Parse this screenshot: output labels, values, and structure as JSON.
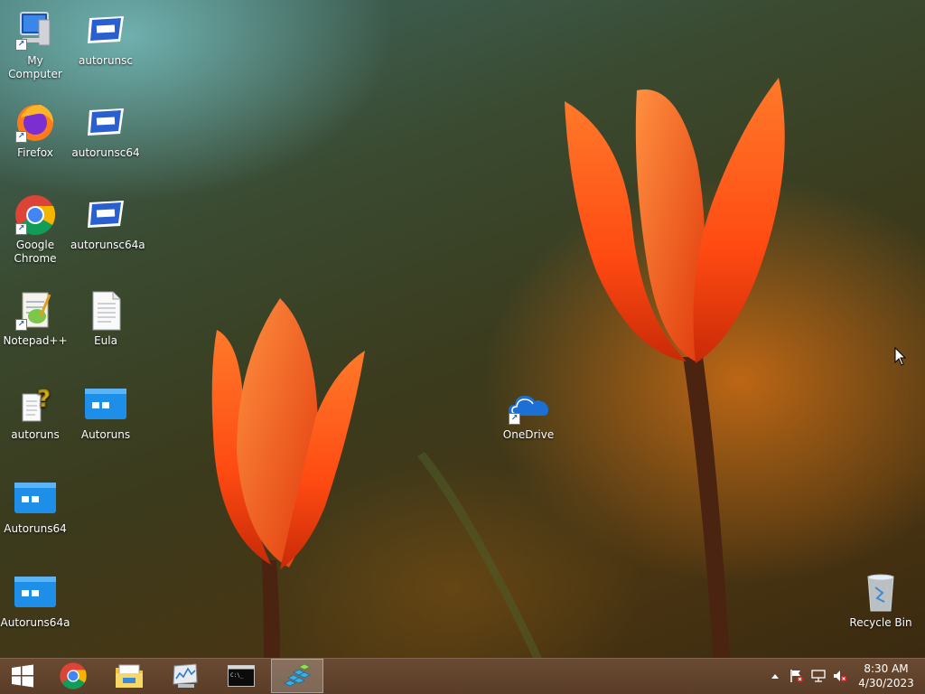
{
  "desktop": {
    "icons": [
      {
        "label": "My Computer",
        "icon": "computer-icon"
      },
      {
        "label": "autorunsc",
        "icon": "console-app-icon"
      },
      {
        "label": "Firefox",
        "icon": "firefox-icon"
      },
      {
        "label": "autorunsc64",
        "icon": "console-app-icon"
      },
      {
        "label": "Google Chrome",
        "icon": "chrome-icon"
      },
      {
        "label": "autorunsc64a",
        "icon": "console-app-icon"
      },
      {
        "label": "Notepad++",
        "icon": "notepadpp-icon"
      },
      {
        "label": "Eula",
        "icon": "text-file-icon"
      },
      {
        "label": "autoruns",
        "icon": "help-file-icon"
      },
      {
        "label": "Autoruns",
        "icon": "autoruns-app-icon"
      },
      {
        "label": "Autoruns64",
        "icon": "autoruns-app-icon"
      },
      {
        "label": "Autoruns64a",
        "icon": "autoruns-app-icon"
      },
      {
        "label": "OneDrive",
        "icon": "onedrive-icon"
      },
      {
        "label": "Recycle Bin",
        "icon": "recycle-bin-icon"
      }
    ]
  },
  "taskbar": {
    "start": "windows-logo-icon",
    "pinned": [
      "chrome-icon",
      "file-explorer-icon",
      "resource-monitor-icon",
      "command-prompt-icon",
      "registry-editor-icon"
    ],
    "active_index": 4,
    "tray": [
      "show-hidden-icons-arrow",
      "action-center-flag-icon",
      "network-icon",
      "volume-muted-icon"
    ],
    "clock": {
      "time": "8:30 AM",
      "date": "4/30/2023"
    }
  },
  "colors": {
    "taskbar": "#5f4230",
    "tulip": "#ff4a12",
    "console_icon": "#2a5fd0",
    "autoruns_icon": "#1e8fe8"
  }
}
